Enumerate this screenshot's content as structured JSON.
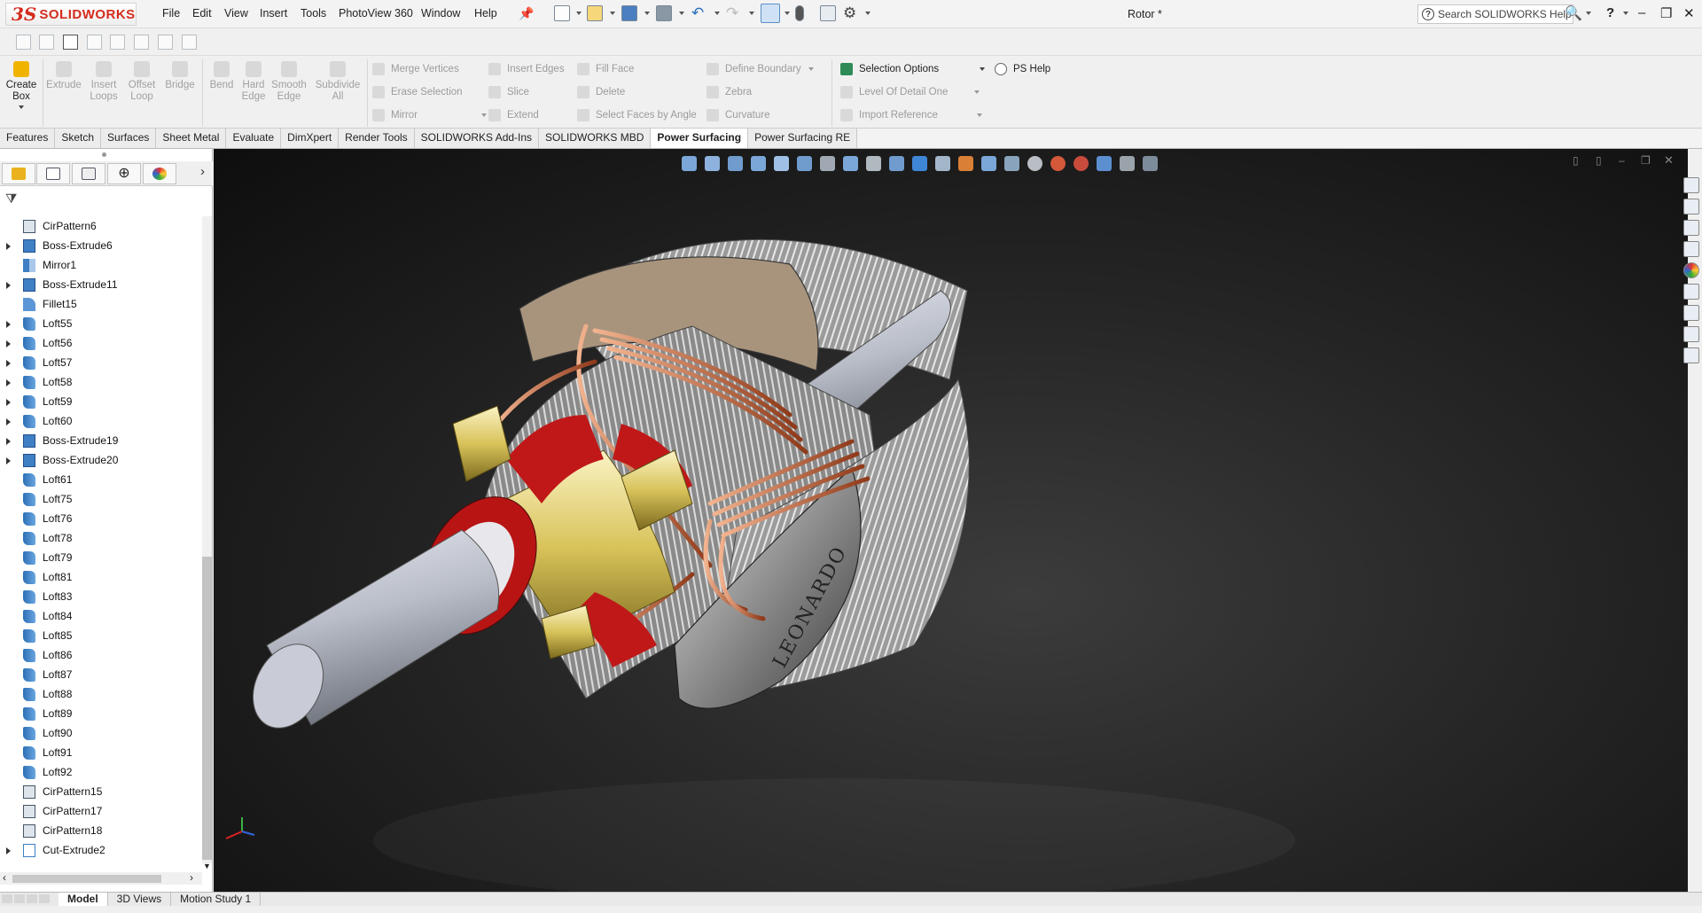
{
  "app": {
    "brand_ds": "3S",
    "brand_name": "SOLIDWORKS",
    "document_title": "Rotor *"
  },
  "menu": [
    "File",
    "Edit",
    "View",
    "Insert",
    "Tools",
    "PhotoView 360",
    "Window",
    "Help"
  ],
  "search": {
    "placeholder": "Search SOLIDWORKS Help"
  },
  "commands": {
    "create_box": "Create Box",
    "big_buttons": [
      "Extrude",
      "Insert Loops",
      "Offset Loop",
      "Bridge",
      "Bend",
      "Hard Edge",
      "Smooth Edge",
      "Subdivide All"
    ],
    "col1": [
      "Merge Vertices",
      "Erase Selection",
      "Mirror"
    ],
    "col2": [
      "Insert Edges",
      "Slice",
      "Extend"
    ],
    "col3": [
      "Fill Face",
      "Delete",
      "Select Faces by Angle"
    ],
    "col4": [
      "Define Boundary",
      "Zebra",
      "Curvature"
    ],
    "col5": [
      "Selection Options",
      "Level Of Detail One",
      "Import Reference"
    ],
    "ps_help": "PS Help"
  },
  "tabs": [
    "Features",
    "Sketch",
    "Surfaces",
    "Sheet Metal",
    "Evaluate",
    "DimXpert",
    "Render Tools",
    "SOLIDWORKS Add-Ins",
    "SOLIDWORKS MBD",
    "Power Surfacing",
    "Power Surfacing RE"
  ],
  "selected_tab": "Power Surfacing",
  "tree": [
    {
      "label": "CirPattern6",
      "icon": "pattern",
      "expandable": false
    },
    {
      "label": "Boss-Extrude6",
      "icon": "boss",
      "expandable": true
    },
    {
      "label": "Mirror1",
      "icon": "mirror",
      "expandable": false
    },
    {
      "label": "Boss-Extrude11",
      "icon": "boss",
      "expandable": true
    },
    {
      "label": "Fillet15",
      "icon": "fillet",
      "expandable": false
    },
    {
      "label": "Loft55",
      "icon": "loft",
      "expandable": true
    },
    {
      "label": "Loft56",
      "icon": "loft",
      "expandable": true
    },
    {
      "label": "Loft57",
      "icon": "loft",
      "expandable": true
    },
    {
      "label": "Loft58",
      "icon": "loft",
      "expandable": true
    },
    {
      "label": "Loft59",
      "icon": "loft",
      "expandable": true
    },
    {
      "label": "Loft60",
      "icon": "loft",
      "expandable": true
    },
    {
      "label": "Boss-Extrude19",
      "icon": "boss",
      "expandable": true
    },
    {
      "label": "Boss-Extrude20",
      "icon": "boss",
      "expandable": true
    },
    {
      "label": "Loft61",
      "icon": "loft",
      "expandable": false
    },
    {
      "label": "Loft75",
      "icon": "loft",
      "expandable": false
    },
    {
      "label": "Loft76",
      "icon": "loft",
      "expandable": false
    },
    {
      "label": "Loft78",
      "icon": "loft",
      "expandable": false
    },
    {
      "label": "Loft79",
      "icon": "loft",
      "expandable": false
    },
    {
      "label": "Loft81",
      "icon": "loft",
      "expandable": false
    },
    {
      "label": "Loft83",
      "icon": "loft",
      "expandable": false
    },
    {
      "label": "Loft84",
      "icon": "loft",
      "expandable": false
    },
    {
      "label": "Loft85",
      "icon": "loft",
      "expandable": false
    },
    {
      "label": "Loft86",
      "icon": "loft",
      "expandable": false
    },
    {
      "label": "Loft87",
      "icon": "loft",
      "expandable": false
    },
    {
      "label": "Loft88",
      "icon": "loft",
      "expandable": false
    },
    {
      "label": "Loft89",
      "icon": "loft",
      "expandable": false
    },
    {
      "label": "Loft90",
      "icon": "loft",
      "expandable": false
    },
    {
      "label": "Loft91",
      "icon": "loft",
      "expandable": false
    },
    {
      "label": "Loft92",
      "icon": "loft",
      "expandable": false
    },
    {
      "label": "CirPattern15",
      "icon": "pattern",
      "expandable": false
    },
    {
      "label": "CirPattern17",
      "icon": "pattern",
      "expandable": false
    },
    {
      "label": "CirPattern18",
      "icon": "pattern",
      "expandable": false
    },
    {
      "label": "Cut-Extrude2",
      "icon": "cut",
      "expandable": true
    }
  ],
  "model_engraving": "LEONARDO",
  "bottom_tabs": [
    "Model",
    "3D Views",
    "Motion Study 1"
  ],
  "colors": {
    "brand_red": "#d52b1e",
    "copper": "#c8663a",
    "rotor_red": "#c01818",
    "brass": "#d8c35a"
  }
}
